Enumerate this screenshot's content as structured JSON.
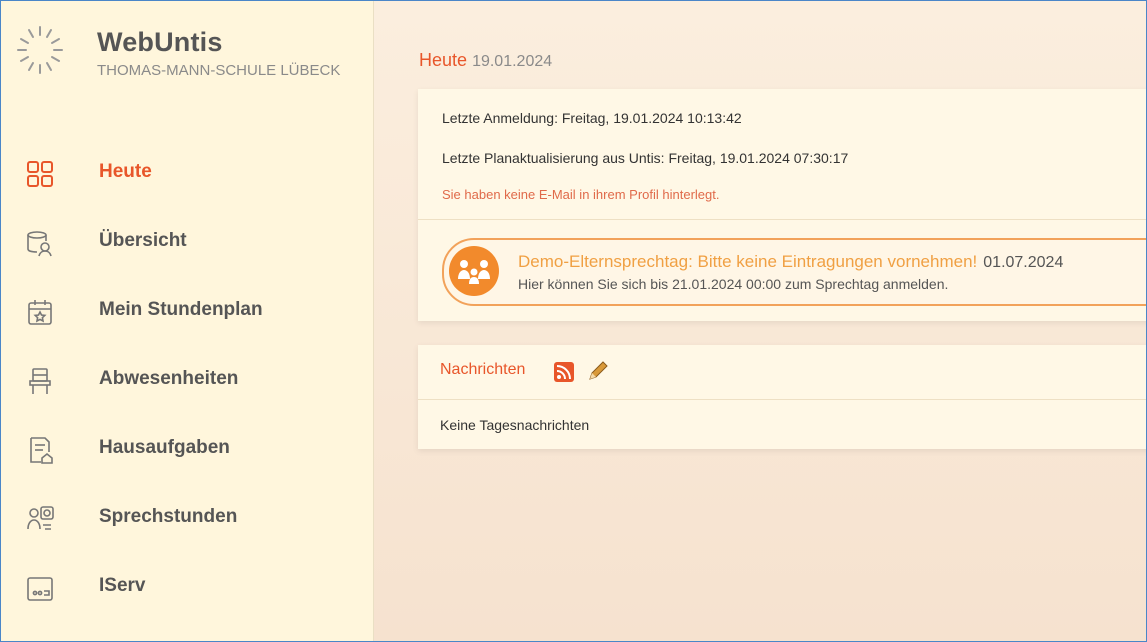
{
  "brand": {
    "title": "WebUntis",
    "school": "THOMAS-MANN-SCHULE LÜBECK"
  },
  "nav": {
    "items": [
      {
        "label": "Heute",
        "icon": "dashboard-icon",
        "active": true
      },
      {
        "label": "Übersicht",
        "icon": "overview-icon",
        "active": false
      },
      {
        "label": "Mein Stundenplan",
        "icon": "calendar-icon",
        "active": false
      },
      {
        "label": "Abwesenheiten",
        "icon": "chair-icon",
        "active": false
      },
      {
        "label": "Hausaufgaben",
        "icon": "homework-icon",
        "active": false
      },
      {
        "label": "Sprechstunden",
        "icon": "office-hours-icon",
        "active": false
      },
      {
        "label": "IServ",
        "icon": "iserv-icon",
        "active": false
      }
    ]
  },
  "main": {
    "title": "Heute",
    "date": "19.01.2024",
    "login": {
      "last_login": "Letzte Anmeldung: Freitag, 19.01.2024 10:13:42",
      "last_update": "Letzte Planaktualisierung aus Untis: Freitag, 19.01.2024 07:30:17",
      "warning": "Sie haben keine E-Mail in ihrem Profil hinterlegt."
    },
    "banner": {
      "title": "Demo-Elternsprechtag: Bitte keine Eintragungen vornehmen!",
      "date": "01.07.2024",
      "text": "Hier können Sie sich bis 21.01.2024 00:00 zum Sprechtag anmelden."
    },
    "news": {
      "heading": "Nachrichten",
      "empty": "Keine Tagesnachrichten"
    }
  },
  "colors": {
    "accent": "#e8562a",
    "banner_orange": "#f28a2c",
    "sidebar_bg": "#fff6dc"
  }
}
